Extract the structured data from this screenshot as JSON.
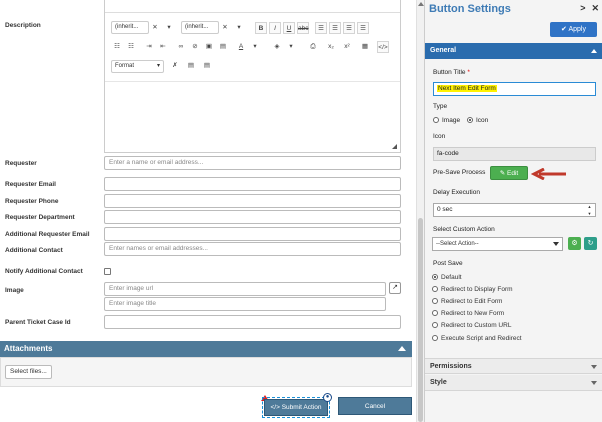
{
  "form": {
    "description_label": "Description",
    "editor": {
      "font_family": "(inherit...",
      "font_size": "(inherit...",
      "format": "Format"
    },
    "requester": {
      "label": "Requester",
      "placeholder": "Enter a name or email address..."
    },
    "requester_email": {
      "label": "Requester Email"
    },
    "requester_phone": {
      "label": "Requester Phone"
    },
    "requester_department": {
      "label": "Requester Department"
    },
    "additional_requester_email": {
      "label": "Additional Requester Email"
    },
    "additional_contact": {
      "label": "Additional Contact",
      "placeholder": "Enter names or email addresses..."
    },
    "notify_additional_contact": {
      "label": "Notify Additional Contact"
    },
    "image": {
      "label": "Image",
      "url_placeholder": "Enter image url",
      "title_placeholder": "Enter image title"
    },
    "parent_ticket": {
      "label": "Parent Ticket Case Id"
    },
    "attachments": {
      "title": "Attachments",
      "select_files": "Select files..."
    },
    "submit_label": "</> Submit Action",
    "cancel_label": "Cancel"
  },
  "panel": {
    "title": "Button Settings",
    "apply_label": "✔ Apply",
    "general_label": "General",
    "button_title": {
      "label": "Button Title",
      "required_mark": "*",
      "value": "Next Item Edit Form"
    },
    "type": {
      "label": "Type",
      "options": [
        "Image",
        "Icon"
      ],
      "selected": "Icon"
    },
    "icon": {
      "label": "Icon",
      "value": "fa-code"
    },
    "pre_save": {
      "label": "Pre-Save Process",
      "edit_label": "✎ Edit"
    },
    "delay": {
      "label": "Delay Execution",
      "value": "0 sec"
    },
    "custom_action": {
      "label": "Select Custom Action",
      "value": "--Select Action--"
    },
    "post_save": {
      "label": "Post Save",
      "options": [
        "Default",
        "Redirect to Display Form",
        "Redirect to Edit Form",
        "Redirect to New Form",
        "Redirect to Custom URL",
        "Execute Script and Redirect"
      ],
      "selected": "Default"
    },
    "permissions_label": "Permissions",
    "style_label": "Style"
  },
  "colors": {
    "accent": "#2a6cae",
    "bar": "#4e7a99",
    "edit_green": "#4caf50",
    "highlight": "#fff200",
    "arrow_red": "#c0392b"
  }
}
